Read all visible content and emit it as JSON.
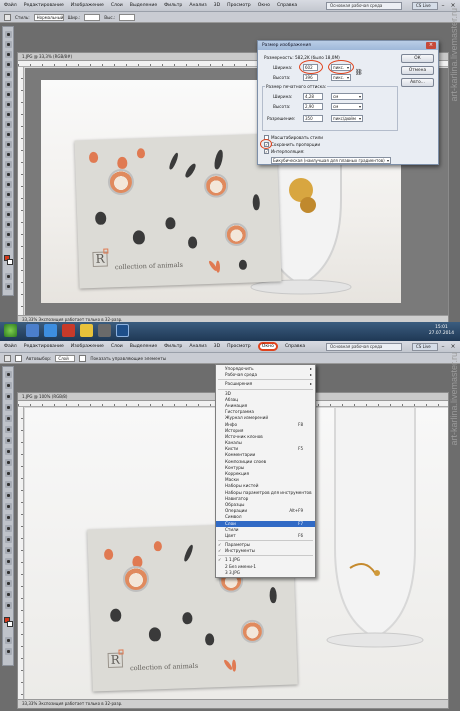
{
  "menu": [
    "Файл",
    "Редактирование",
    "Изображение",
    "Слои",
    "Выделение",
    "Фильтр",
    "Анализ",
    "3D",
    "Просмотр",
    "Окно",
    "Справка"
  ],
  "menu_active": "Окно",
  "workspace_button": "Основная рабочая среда",
  "cs_live": "CS Live",
  "top": {
    "options": {
      "style_label": "Стиль:",
      "style_value": "Нормальный",
      "width_label": "Шир.:",
      "height_label": "Выс.:"
    },
    "doc_title": "1.JPG @ 33,3% (RGB/8#)",
    "status": "33,33%   Экспозиция работает только в 32-разр.",
    "card_text": "collection of animals",
    "logo_letter": "R",
    "dialog": {
      "title": "Размер изображения",
      "dimensions_label": "Размерность:",
      "dimensions_value": "582,2K (было 18,0M)",
      "pixel_width_label": "Ширина:",
      "pixel_width_value": "602",
      "pixel_width_unit": "пикс.",
      "pixel_height_label": "Высота:",
      "pixel_height_value": "396",
      "pixel_height_unit": "пикс.",
      "print_size_label": "Размер печатного оттиска:",
      "print_width_label": "Ширина:",
      "print_width_value": "4,28",
      "print_width_unit": "см",
      "print_height_label": "Высота:",
      "print_height_value": "2,90",
      "print_height_unit": "см",
      "resolution_label": "Разрешение:",
      "resolution_value": "350",
      "resolution_unit": "пикс/дюйм",
      "scale_styles": "Масштабировать стили",
      "constrain": "Сохранить пропорции",
      "resample": "Интерполяция:",
      "method": "Бикубическая (наилучшая для плавных градиентов)",
      "ok": "ОК",
      "cancel": "Отмена",
      "auto": "Авто..."
    }
  },
  "bottom": {
    "clock_time": "15:01",
    "clock_date": "27.07.2014",
    "options": {
      "autoselect_label": "Автовыбор:",
      "autoselect_value": "Слой",
      "transform_label": "Показать управляющие элементы"
    },
    "doc_title": "1.JPG @ 100% (RGB/8)",
    "status": "33,33%   Экспозиция работает только в 32-разр.",
    "card_text": "collection of animals",
    "logo_letter": "R",
    "window_menu": [
      {
        "label": "Упорядочить",
        "arrow": true
      },
      {
        "label": "Рабочая среда",
        "arrow": true
      },
      {
        "sep": true
      },
      {
        "label": "Расширения",
        "arrow": true
      },
      {
        "sep": true
      },
      {
        "label": "3D"
      },
      {
        "label": "Абзац"
      },
      {
        "label": "Анимация"
      },
      {
        "label": "Гистограмма"
      },
      {
        "label": "Журнал измерений"
      },
      {
        "label": "Инфо",
        "shortcut": "F8"
      },
      {
        "label": "История"
      },
      {
        "label": "Источник клонов"
      },
      {
        "label": "Каналы"
      },
      {
        "label": "Кисти",
        "shortcut": "F5"
      },
      {
        "label": "Комментарии"
      },
      {
        "label": "Композиции слоев"
      },
      {
        "label": "Контуры"
      },
      {
        "label": "Коррекция"
      },
      {
        "label": "Маски"
      },
      {
        "label": "Наборы кистей"
      },
      {
        "label": "Наборы параметров для инструментов"
      },
      {
        "label": "Навигатор"
      },
      {
        "label": "Образцы"
      },
      {
        "label": "Операции",
        "shortcut": "Alt+F9"
      },
      {
        "label": "Символ"
      },
      {
        "label": "Слои",
        "shortcut": "F7",
        "selected": true
      },
      {
        "label": "Стили"
      },
      {
        "label": "Цвет",
        "shortcut": "F6"
      },
      {
        "sep": true
      },
      {
        "label": "Параметры",
        "check": true
      },
      {
        "label": "Инструменты",
        "check": true
      },
      {
        "sep": true
      },
      {
        "label": "1 1.JPG",
        "check": true
      },
      {
        "label": "2 Без имени-1"
      },
      {
        "label": "3 3.JPG"
      }
    ]
  },
  "credit_top": "art-karlina.livemaster.ru",
  "credit_bottom": "art-karlina.livemaster.ru",
  "colors": {
    "accent_red": "#e0431d",
    "ps_bg": "#6d6d6d",
    "menu_highlight": "#316ac5"
  }
}
